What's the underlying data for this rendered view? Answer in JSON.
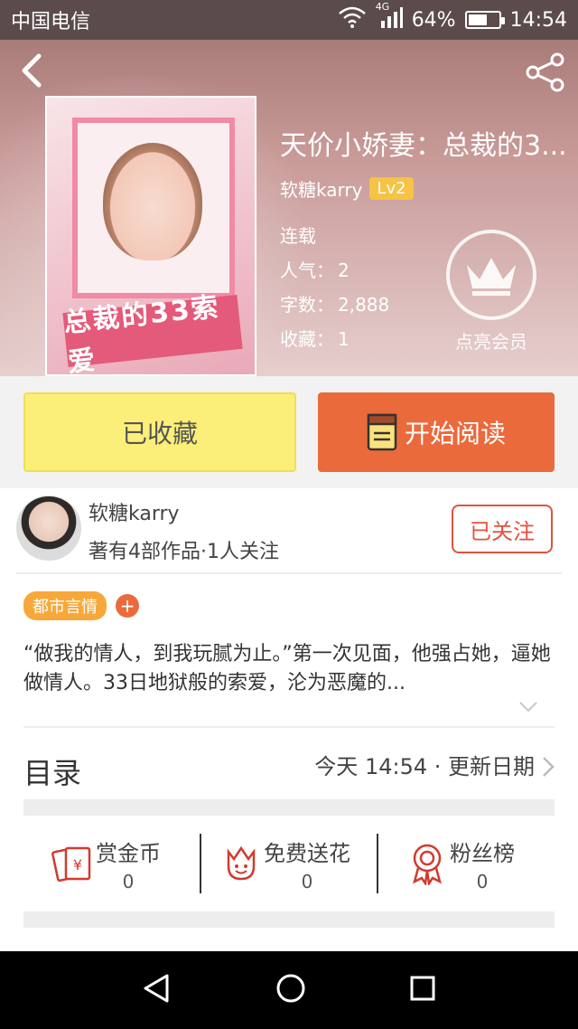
{
  "status_bar": {
    "carrier": "中国电信",
    "network": "4G",
    "battery": "64%",
    "battery_level": 0.64,
    "time": "14:54"
  },
  "header": {
    "book_title": "天价小娇妻：总裁的3...",
    "author_name": "软糖karry",
    "level_badge": "Lv2",
    "status": "连载",
    "popularity_label": "人气：",
    "popularity": "2",
    "word_count_label": "字数：",
    "word_count": "2,888",
    "favorites_label": "收藏：",
    "favorites": "1",
    "vip_label": "点亮会员",
    "cover_banner": "总裁的33索爱"
  },
  "actions": {
    "favorite_label": "已收藏",
    "read_label": "开始阅读"
  },
  "author_card": {
    "name": "软糖karry",
    "summary": "著有4部作品·1人关注",
    "follow_label": "已关注"
  },
  "tags": [
    "都市言情"
  ],
  "description": "“做我的情人，到我玩腻为止。”第一次见面，他强占她，逼她做情人。33日地狱般的索爱，沦为恶魔的...",
  "toc": {
    "title": "目录",
    "update_text": "今天 14:54 · 更新日期"
  },
  "stats": [
    {
      "label": "赏金币",
      "value": "0",
      "icon": "red-envelope-icon"
    },
    {
      "label": "免费送花",
      "value": "0",
      "icon": "flower-icon"
    },
    {
      "label": "粉丝榜",
      "value": "0",
      "icon": "medal-icon"
    }
  ],
  "colors": {
    "accent_orange": "#ea6a3c",
    "favorite_yellow": "#fbef79",
    "follow_red": "#e2523f",
    "tag_orange": "#f6a93a",
    "level_badge": "#f6c343"
  }
}
